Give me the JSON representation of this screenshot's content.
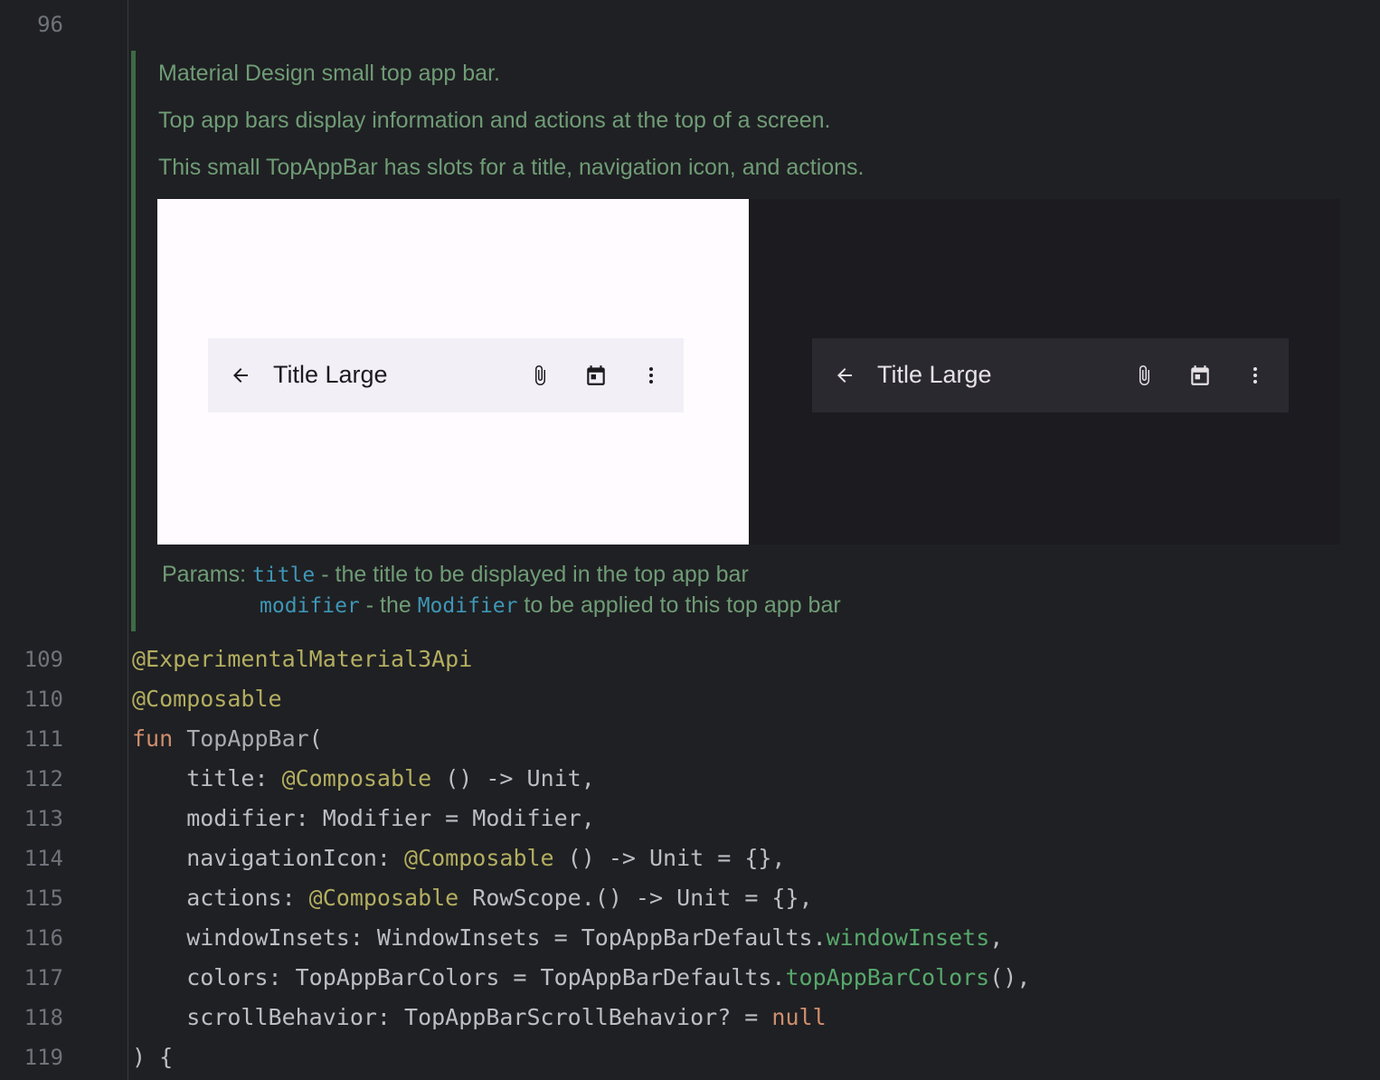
{
  "gutter": {
    "top_line": "96",
    "lines": [
      "109",
      "110",
      "111",
      "112",
      "113",
      "114",
      "115",
      "116",
      "117",
      "118",
      "119"
    ]
  },
  "doc": {
    "line1": "Material Design small top app bar.",
    "line2": "Top app bars display information and actions at the top of a screen.",
    "line3": "This small TopAppBar has slots for a title, navigation icon, and actions.",
    "params_label": "Params:",
    "param1_name": "title",
    "param1_desc": " - the title to be displayed in the top app bar",
    "param2_name": "modifier",
    "param2_desc_a": " - the ",
    "param2_ref": "Modifier",
    "param2_desc_b": " to be applied to this top app bar"
  },
  "preview": {
    "light_title": "Title Large",
    "dark_title": "Title Large",
    "icons": [
      "arrow-back-icon",
      "attach-icon",
      "calendar-icon",
      "more-vert-icon"
    ]
  },
  "code": {
    "l109": "@ExperimentalMaterial3Api",
    "l110": "@Composable",
    "l111_kw": "fun",
    "l111_name": " TopAppBar",
    "l111_paren": "(",
    "l112_a": "    title: ",
    "l112_ann": "@Composable",
    "l112_b": " () -> Unit,",
    "l113": "    modifier: Modifier = Modifier,",
    "l114_a": "    navigationIcon: ",
    "l114_ann": "@Composable",
    "l114_b": " () -> Unit = {},",
    "l115_a": "    actions: ",
    "l115_ann": "@Composable",
    "l115_b": " RowScope.() -> Unit = {},",
    "l116_a": "    windowInsets: WindowInsets = TopAppBarDefaults.",
    "l116_prop": "windowInsets",
    "l116_b": ",",
    "l117_a": "    colors: TopAppBarColors = TopAppBarDefaults.",
    "l117_prop": "topAppBarColors",
    "l117_b": "(),",
    "l118_a": "    scrollBehavior: TopAppBarScrollBehavior? = ",
    "l118_null": "null",
    "l119": ") {"
  }
}
